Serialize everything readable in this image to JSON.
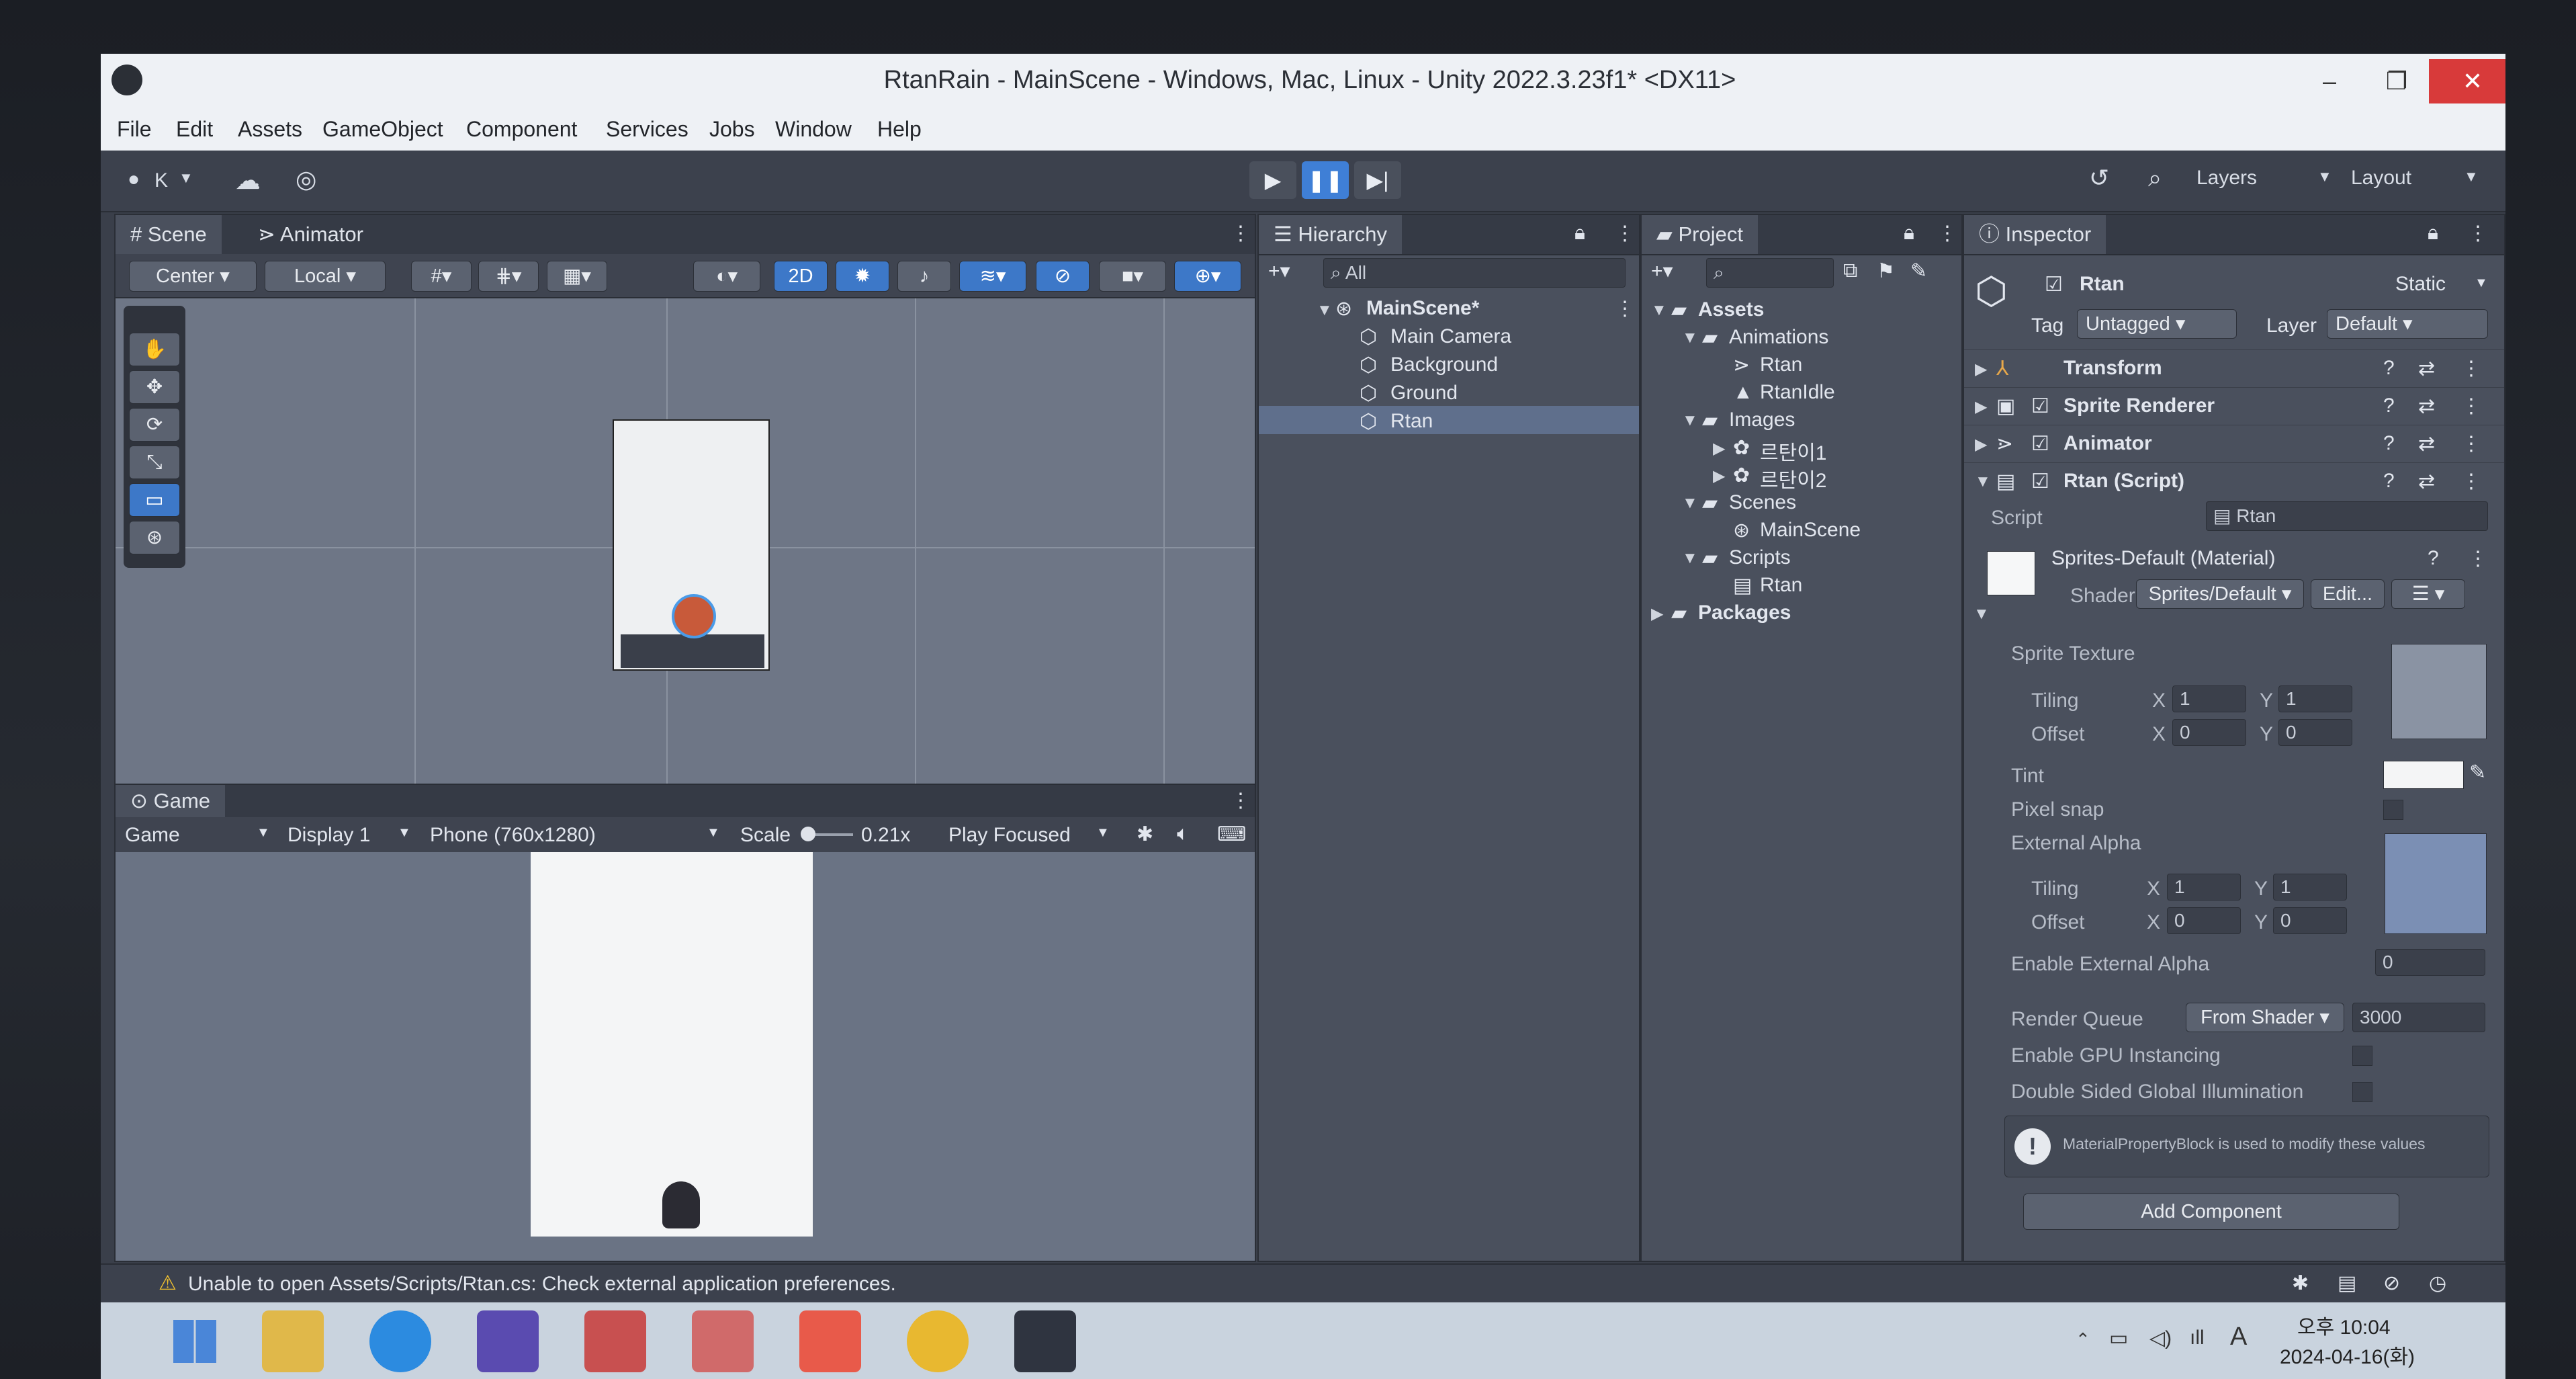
{
  "window": {
    "title": "RtanRain - MainScene - Windows, Mac, Linux - Unity 2022.3.23f1* <DX11>",
    "minimize": "–",
    "maximize": "❐",
    "close": "✕"
  },
  "menu": [
    "File",
    "Edit",
    "Assets",
    "GameObject",
    "Component",
    "Services",
    "Jobs",
    "Window",
    "Help"
  ],
  "toolbar": {
    "account": "K",
    "layers": "Layers",
    "layout": "Layout"
  },
  "scene": {
    "tab_scene": "Scene",
    "tab_animator": "Animator",
    "pivot": "Center",
    "space": "Local",
    "mode_2d": "2D"
  },
  "game": {
    "tab": "Game",
    "view": "Game",
    "display": "Display 1",
    "resolution": "Phone (760x1280)",
    "scale_label": "Scale",
    "scale_value": "0.21x",
    "play_mode": "Play Focused"
  },
  "hierarchy": {
    "tab": "Hierarchy",
    "search": "All",
    "scene": "MainScene*",
    "items": [
      "Main Camera",
      "Background",
      "Ground",
      "Rtan"
    ],
    "selected": "Rtan"
  },
  "project": {
    "tab": "Project",
    "tree": [
      {
        "label": "Assets",
        "depth": 0,
        "kind": "folder",
        "open": true,
        "bold": true
      },
      {
        "label": "Animations",
        "depth": 1,
        "kind": "folder",
        "open": true
      },
      {
        "label": "Rtan",
        "depth": 2,
        "kind": "anim"
      },
      {
        "label": "RtanIdle",
        "depth": 2,
        "kind": "clip"
      },
      {
        "label": "Images",
        "depth": 1,
        "kind": "folder",
        "open": true
      },
      {
        "label": "르탄이1",
        "depth": 2,
        "kind": "sprite",
        "collapsed": true
      },
      {
        "label": "르탄이2",
        "depth": 2,
        "kind": "sprite",
        "collapsed": true
      },
      {
        "label": "Scenes",
        "depth": 1,
        "kind": "folder",
        "open": true
      },
      {
        "label": "MainScene",
        "depth": 2,
        "kind": "scene"
      },
      {
        "label": "Scripts",
        "depth": 1,
        "kind": "folder",
        "open": true
      },
      {
        "label": "Rtan",
        "depth": 2,
        "kind": "script"
      },
      {
        "label": "Packages",
        "depth": 0,
        "kind": "folder",
        "collapsed": true,
        "bold": true
      }
    ]
  },
  "inspector": {
    "tab": "Inspector",
    "object_name": "Rtan",
    "static": "Static",
    "tag_label": "Tag",
    "tag_value": "Untagged",
    "layer_label": "Layer",
    "layer_value": "Default",
    "components": [
      "Transform",
      "Sprite Renderer",
      "Animator",
      "Rtan (Script)"
    ],
    "script_label": "Script",
    "script_value": "Rtan",
    "material_name": "Sprites-Default (Material)",
    "shader_label": "Shader",
    "shader_value": "Sprites/Default",
    "edit_button": "Edit...",
    "sprite_texture": "Sprite Texture",
    "tiling": "Tiling",
    "offset": "Offset",
    "x": "X",
    "y": "Y",
    "tiling_x": "1",
    "tiling_y": "1",
    "offset_x": "0",
    "offset_y": "0",
    "tint": "Tint",
    "pixel_snap": "Pixel snap",
    "external_alpha": "External Alpha",
    "tiling2_x": "1",
    "tiling2_y": "1",
    "offset2_x": "0",
    "offset2_y": "0",
    "enable_external_alpha": "Enable External Alpha",
    "enable_external_alpha_value": "0",
    "render_queue": "Render Queue",
    "render_queue_source": "From Shader",
    "render_queue_value": "3000",
    "gpu_instancing": "Enable GPU Instancing",
    "double_sided": "Double Sided Global Illumination",
    "info_text": "MaterialPropertyBlock is used to modify these values",
    "add_component": "Add Component"
  },
  "status": {
    "message": "Unable to open Assets/Scripts/Rtan.cs: Check external application preferences."
  },
  "taskbar": {
    "ime": "A",
    "time": "오후 10:04",
    "date": "2024-04-16(화)"
  },
  "colors": {
    "accent_blue": "#3f7fd6",
    "close_red": "#d83a3a",
    "warning_yellow": "#f2c230"
  }
}
